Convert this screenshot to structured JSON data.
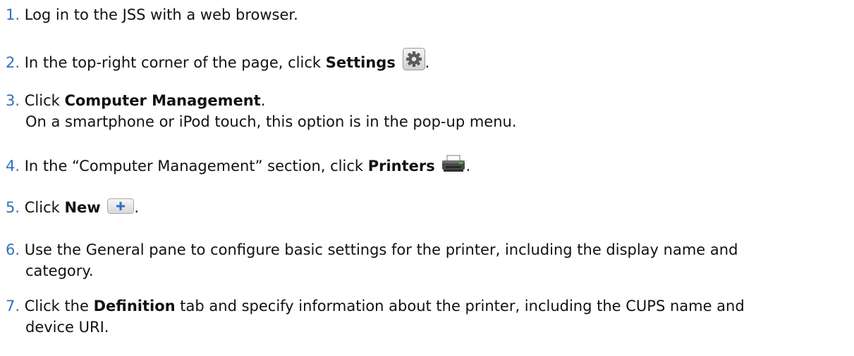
{
  "steps": [
    {
      "number": "1.",
      "text": "Log in to the JSS with a web browser."
    },
    {
      "number": "2.",
      "pre": "In the top-right corner of the page, click ",
      "bold": "Settings",
      "icon": "gear-icon",
      "post": "."
    },
    {
      "number": "3.",
      "pre": "Click ",
      "bold": "Computer Management",
      "post": ".",
      "sub": "On a smartphone or iPod touch, this option is in the pop-up menu."
    },
    {
      "number": "4.",
      "pre": "In the “Computer Management” section, click ",
      "bold": "Printers",
      "icon": "printer-icon",
      "post": "."
    },
    {
      "number": "5.",
      "pre": "Click ",
      "bold": "New",
      "icon": "plus-icon",
      "post": "."
    },
    {
      "number": "6.",
      "line1": "Use the General pane to configure basic settings for the printer, including the display name and",
      "line2": "category."
    },
    {
      "number": "7.",
      "pre": "Click the ",
      "bold": "Definition",
      "post": " tab and specify information about the printer, including the CUPS name and",
      "line2": "device URI."
    }
  ],
  "colors": {
    "number": "#2f70bf",
    "text": "#111111"
  }
}
